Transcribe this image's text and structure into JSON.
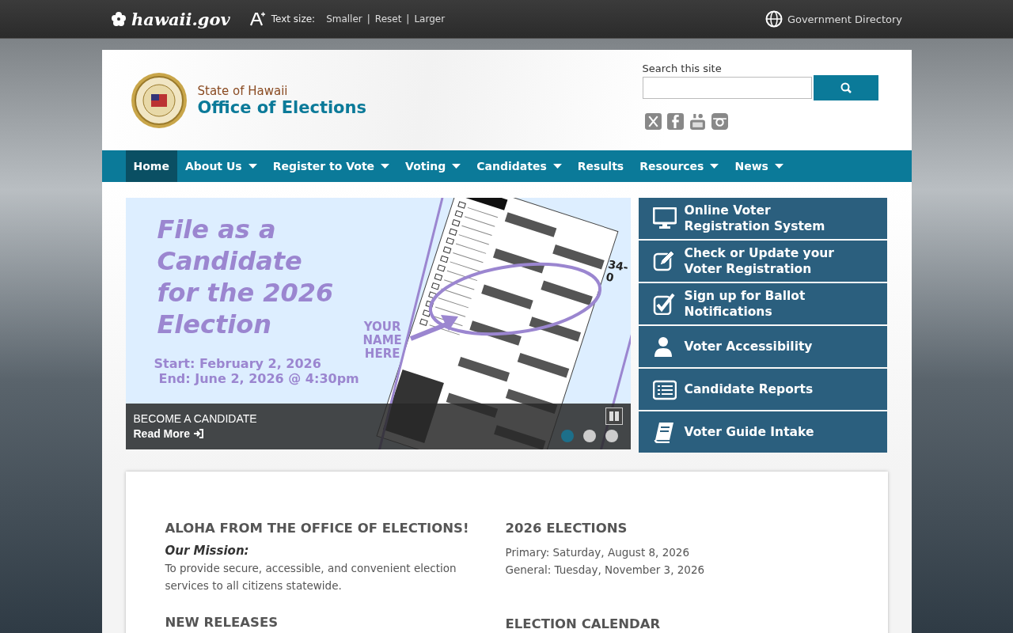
{
  "gov_bar": {
    "logo": "hawaii.gov",
    "text_size_label": "Text size:",
    "text_size_links": [
      "Smaller",
      "Reset",
      "Larger"
    ],
    "separator": "|",
    "directory": "Government Directory"
  },
  "header": {
    "agency": "State of Hawaii",
    "title": "Office of Elections",
    "search_label": "Search this site"
  },
  "nav": [
    {
      "label": "Home",
      "has_menu": false,
      "selected": true
    },
    {
      "label": "About Us",
      "has_menu": true,
      "selected": false
    },
    {
      "label": "Register to Vote",
      "has_menu": true,
      "selected": false
    },
    {
      "label": "Voting",
      "has_menu": true,
      "selected": false
    },
    {
      "label": "Candidates",
      "has_menu": true,
      "selected": false
    },
    {
      "label": "Results",
      "has_menu": false,
      "selected": false
    },
    {
      "label": "Resources",
      "has_menu": true,
      "selected": false
    },
    {
      "label": "News",
      "has_menu": true,
      "selected": false
    }
  ],
  "slider": {
    "headline": [
      "File as a",
      "Candidate",
      "for the 2026",
      "Election"
    ],
    "start": "Start: February 2, 2026",
    "end": "End: June 2, 2026 @ 4:30pm",
    "callout": [
      "YOUR",
      "NAME",
      "HERE"
    ],
    "ballot_number": "34-0",
    "caption": "BECOME A CANDIDATE",
    "read_more": "Read More",
    "dots": [
      {
        "selected": true
      },
      {
        "selected": false
      },
      {
        "selected": false
      }
    ]
  },
  "quick_links": [
    {
      "kind": "monitor",
      "label": "Online Voter Registration System"
    },
    {
      "kind": "edit",
      "label": "Check or Update your Voter Registration"
    },
    {
      "kind": "checkbox",
      "label": "Sign up for Ballot Notifications"
    },
    {
      "kind": "user",
      "label": "Voter Accessibility"
    },
    {
      "kind": "list",
      "label": "Candidate Reports"
    },
    {
      "kind": "book",
      "label": "Voter Guide Intake"
    }
  ],
  "content": {
    "columns": [
      {
        "heading": "ALOHA FROM THE OFFICE OF ELECTIONS!",
        "subheading": "Our Mission:",
        "lines": [
          "To provide secure, accessible, and convenient election services to all citizens statewide."
        ],
        "next_heading": "NEW RELEASES"
      },
      {
        "heading": "2026 ELECTIONS",
        "lines": [
          "Primary: Saturday, August 8, 2026",
          "General: Tuesday, November 3, 2026"
        ],
        "next_heading": "ELECTION CALENDAR"
      }
    ]
  }
}
